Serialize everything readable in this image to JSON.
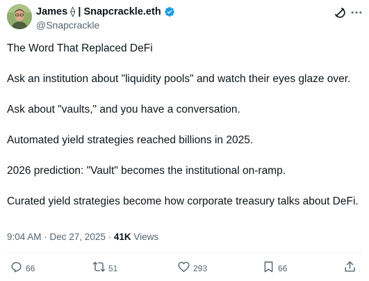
{
  "author": {
    "display_name": "James ⟠ | Snapcrackle.eth",
    "handle": "@Snapcrackle",
    "verified": true,
    "verified_color": "#1d9bf0"
  },
  "tweet": {
    "title": "The Word That Replaced DeFi",
    "paragraphs": [
      "Ask an institution about \"liquidity pools\" and watch their eyes glaze over.",
      "Ask about \"vaults,\" and you have a conversation.",
      "Automated yield strategies reached billions in 2025.",
      "2026 prediction: \"Vault\" becomes the institutional on-ramp.",
      "Curated yield strategies become how corporate treasury talks about DeFi."
    ]
  },
  "meta": {
    "time": "9:04 AM",
    "separator1": " · ",
    "date": "Dec 27, 2025",
    "separator2": " · ",
    "views_count": "41K",
    "views_label": " Views"
  },
  "actions": {
    "replies": "66",
    "reposts": "51",
    "likes": "293",
    "bookmarks": "66"
  },
  "icons": {
    "grok": "grok-icon",
    "more": "more-horizontal-icon",
    "reply": "reply-icon",
    "repost": "repost-icon",
    "like": "heart-icon",
    "bookmark": "bookmark-icon",
    "share": "share-icon"
  },
  "colors": {
    "text": "#0f1419",
    "secondary": "#536471",
    "verified": "#1d9bf0",
    "divider": "#eff3f4"
  }
}
